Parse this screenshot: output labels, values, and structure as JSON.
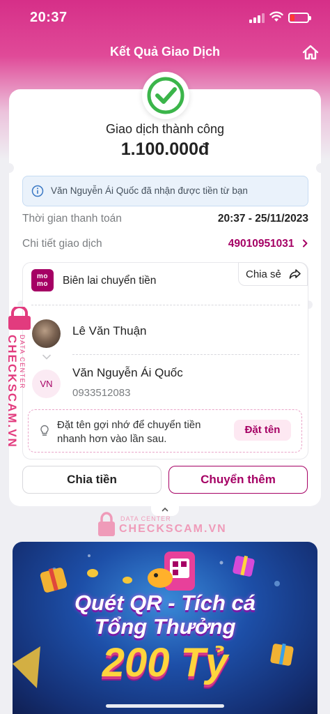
{
  "status_bar": {
    "time": "20:37"
  },
  "nav": {
    "title": "Kết Quả Giao Dịch"
  },
  "result": {
    "status": "Giao dịch thành công",
    "amount": "1.100.000đ"
  },
  "info_notice": "Văn Nguyễn Ái Quốc đã nhận được tiền từ bạn",
  "details": {
    "payment_time_label": "Thời gian thanh toán",
    "payment_time_value": "20:37 - 25/11/2023",
    "transaction_label": "Chi tiết giao dịch",
    "transaction_id": "49010951031"
  },
  "receipt": {
    "logo_text": "mo mo",
    "title": "Biên lai chuyển tiền",
    "share_label": "Chia sẻ",
    "sender_name": "Lê Văn Thuận",
    "receiver_initials": "VN",
    "receiver_name": "Văn Nguyễn Ái Quốc",
    "receiver_phone": "0933512083",
    "nickname_hint": "Đặt tên gợi nhớ để chuyển tiền nhanh hơn vào lần sau.",
    "nickname_button": "Đặt tên"
  },
  "actions": {
    "split_label": "Chia tiền",
    "transfer_more_label": "Chuyển thêm"
  },
  "watermark": {
    "line1": "DATA CENTER",
    "line2": "CHECKSCAM.VN"
  },
  "banner": {
    "line1": "Quét QR - Tích cá",
    "line2": "Tổng Thưởng",
    "line3": "200 Tỷ"
  },
  "colors": {
    "brand": "#a50064",
    "header_pink": "#d62f88",
    "success_green": "#3bb54a"
  },
  "icons": [
    "signal-icon",
    "wifi-icon",
    "battery-icon",
    "home-icon",
    "check-circle-icon",
    "info-icon",
    "chevron-right-icon",
    "share-icon",
    "chevron-down-icon",
    "bulb-icon",
    "chevron-up-icon",
    "lock-icon"
  ]
}
